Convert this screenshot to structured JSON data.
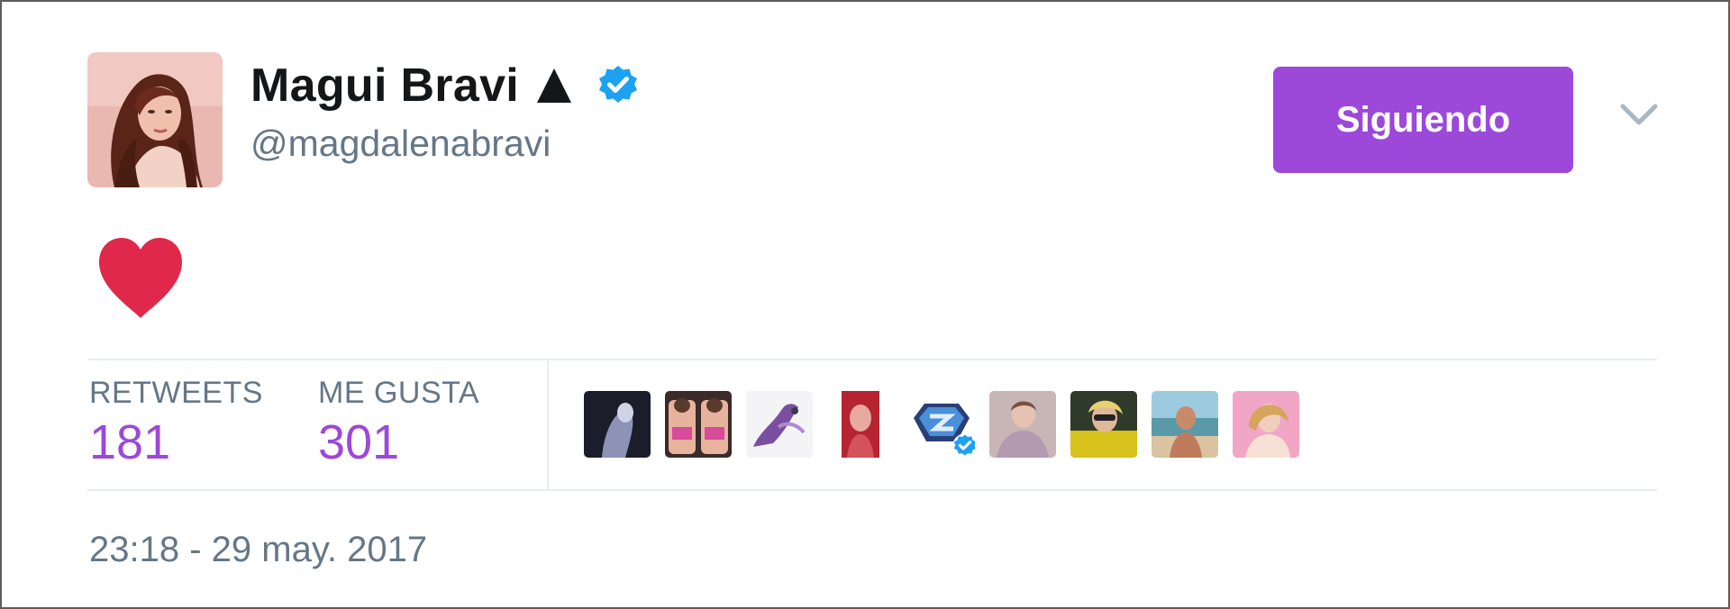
{
  "author": {
    "display_name": "Magui Bravi",
    "handle": "@magdalenabravi",
    "verified": true,
    "avatar_icon": "profile-photo"
  },
  "follow_button": {
    "label": "Siguiendo",
    "color": "#9c48d8"
  },
  "menu": {
    "icon": "chevron-down-icon"
  },
  "tweet": {
    "content_icon": "red-heart-emoji",
    "heart_color": "#e0284a"
  },
  "stats": {
    "retweets": {
      "label": "RETWEETS",
      "value": "181"
    },
    "likes": {
      "label": "ME GUSTA",
      "value": "301"
    },
    "value_color": "#9c48d8"
  },
  "likers": [
    {
      "icon": "liker-avatar-1"
    },
    {
      "icon": "liker-avatar-2"
    },
    {
      "icon": "liker-avatar-3"
    },
    {
      "icon": "liker-avatar-4"
    },
    {
      "icon": "liker-avatar-5",
      "verified": true
    },
    {
      "icon": "liker-avatar-6"
    },
    {
      "icon": "liker-avatar-7"
    },
    {
      "icon": "liker-avatar-8"
    },
    {
      "icon": "liker-avatar-9"
    }
  ],
  "timestamp": "23:18 - 29 may. 2017",
  "colors": {
    "verified_blue": "#1da1f2",
    "muted_text": "#657786",
    "primary_text": "#14171a"
  }
}
